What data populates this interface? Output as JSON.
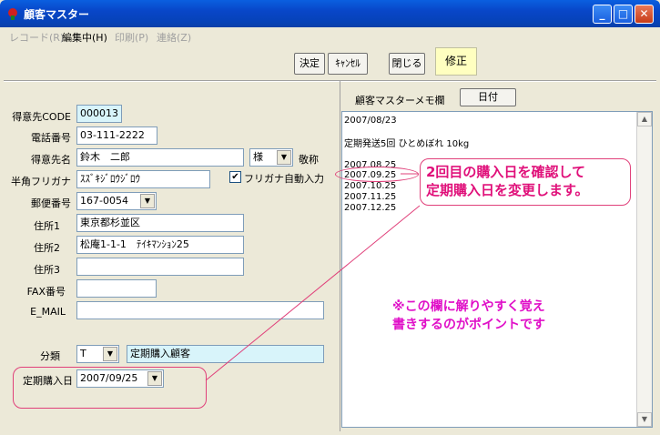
{
  "window": {
    "title": "顧客マスター"
  },
  "menu": [
    {
      "label": "レコード(R)",
      "enabled": false
    },
    {
      "label": "編集中(H)",
      "enabled": true
    },
    {
      "label": "印刷(P)",
      "enabled": false
    },
    {
      "label": "連絡(Z)",
      "enabled": false
    }
  ],
  "toolbar": {
    "decide_label": "決定",
    "cancel_label": "ｷｬﾝｾﾙ",
    "close_label": "閉じる",
    "mode_label": "修正"
  },
  "form": {
    "customer_code": {
      "label": "得意先CODE",
      "value": "000013"
    },
    "phone": {
      "label": "電話番号",
      "value": "03-111-2222"
    },
    "name": {
      "label": "得意先名",
      "value": "鈴木　二郎",
      "honorific": "様",
      "suffix_label": "敬称"
    },
    "kana": {
      "label": "半角フリガナ",
      "value": "ｽｽﾞｷｼﾞﾛｳｼﾞﾛｳ",
      "auto_label": "フリガナ自動入力",
      "auto_checked": true
    },
    "postal": {
      "label": "郵便番号",
      "value": "167-0054"
    },
    "address1": {
      "label": "住所1",
      "value": "東京都杉並区"
    },
    "address2": {
      "label": "住所2",
      "value": "松庵1-1-1　ﾃｲｷﾏﾝｼｮﾝ25"
    },
    "address3": {
      "label": "住所3",
      "value": ""
    },
    "fax": {
      "label": "FAX番号",
      "value": ""
    },
    "email": {
      "label": "E_MAIL",
      "value": ""
    },
    "category": {
      "label": "分類",
      "value": "T",
      "description": "定期購入顧客"
    },
    "purchase_date": {
      "label": "定期購入日",
      "value": "2007/09/25"
    }
  },
  "memo": {
    "header_label": "顧客マスターメモ欄",
    "date_button_label": "日付",
    "lines": [
      "2007/08/23",
      "",
      "定期発送5回  ひとめぼれ  10kg",
      "",
      "2007.08.25",
      "2007.09.25",
      "2007.10.25",
      "2007.11.25",
      "2007.12.25"
    ]
  },
  "annotations": {
    "callout_line1": "2回目の購入日を確認して",
    "callout_line2": "定期購入日を変更します。",
    "note_line1": "※この欄に解りやすく覚え",
    "note_line2": "書きするのがポイントです"
  },
  "colors": {
    "titlebar": "#0A5FE0",
    "annotation_pink": "#E0107A",
    "note_magenta": "#E010C8",
    "highlight_yellow": "#FFFFC0",
    "field_cyan": "#D8F4FA"
  }
}
